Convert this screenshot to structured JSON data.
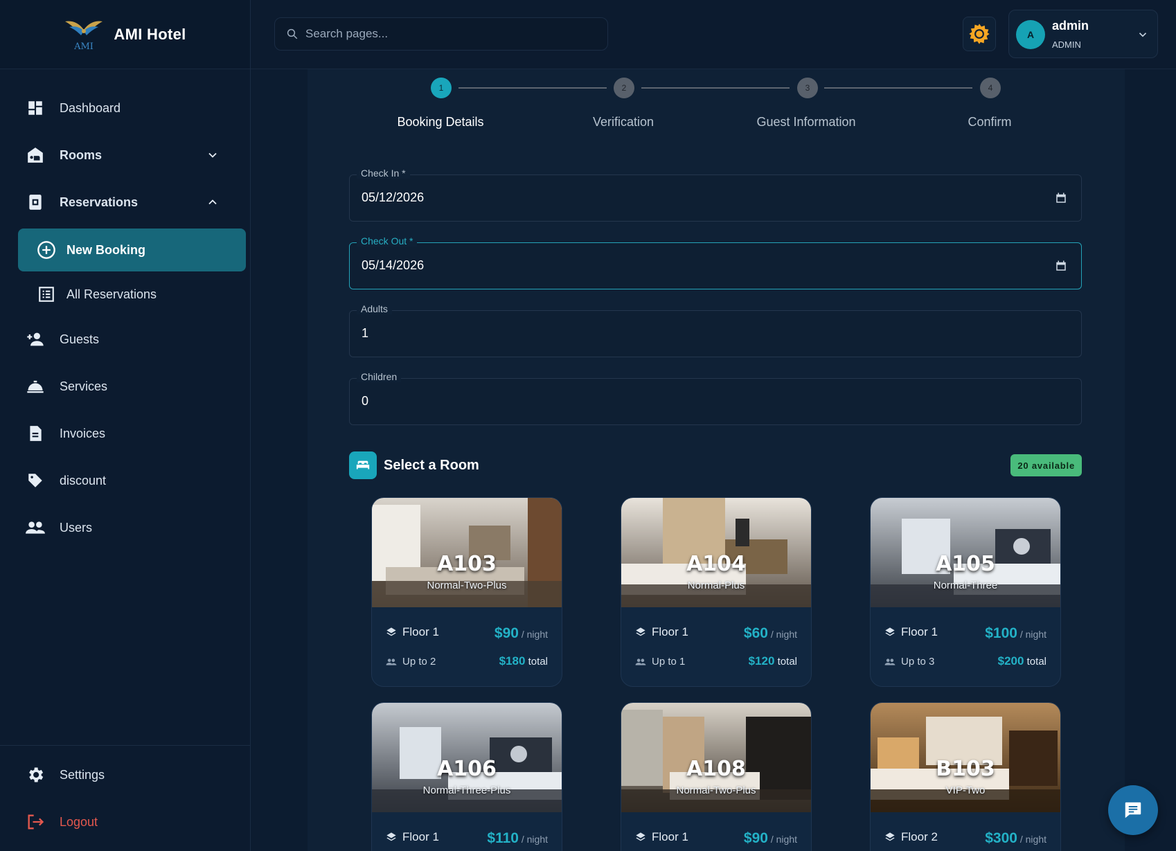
{
  "app": {
    "name": "AMI Hotel",
    "logo_text": "AMI"
  },
  "search": {
    "placeholder": "Search pages..."
  },
  "user": {
    "name": "admin",
    "role": "ADMIN",
    "avatar_letter": "A"
  },
  "sidebar": {
    "items": [
      {
        "label": "Dashboard",
        "icon": "dashboard-icon"
      },
      {
        "label": "Rooms",
        "icon": "hotel-icon"
      },
      {
        "label": "Reservations",
        "icon": "reservations-icon"
      },
      {
        "label": "New Booking",
        "icon": "add-circle-icon",
        "active": true
      },
      {
        "label": "All Reservations",
        "icon": "list-icon"
      },
      {
        "label": "Guests",
        "icon": "add-person-icon"
      },
      {
        "label": "Services",
        "icon": "room-service-icon"
      },
      {
        "label": "Invoices",
        "icon": "document-icon"
      },
      {
        "label": "discount",
        "icon": "tag-icon"
      },
      {
        "label": "Users",
        "icon": "people-icon"
      }
    ],
    "settings_label": "Settings",
    "logout_label": "Logout"
  },
  "stepper": {
    "steps": [
      {
        "number": "1",
        "label": "Booking Details",
        "active": true
      },
      {
        "number": "2",
        "label": "Verification"
      },
      {
        "number": "3",
        "label": "Guest Information"
      },
      {
        "number": "4",
        "label": "Confirm"
      }
    ]
  },
  "form": {
    "check_in": {
      "label": "Check In *",
      "value": "05/12/2026"
    },
    "check_out": {
      "label": "Check Out *",
      "value": "05/14/2026"
    },
    "adults": {
      "label": "Adults",
      "value": "1"
    },
    "children": {
      "label": "Children",
      "value": "0"
    }
  },
  "rooms_section": {
    "title": "Select a Room",
    "available_badge": "20 available"
  },
  "rooms": [
    {
      "number": "A103",
      "type": "Normal-Two-Plus",
      "floor": "Floor 1",
      "price": "$90",
      "per": "/ night",
      "capacity": "Up to 2",
      "total": "$180",
      "total_suffix": "total"
    },
    {
      "number": "A104",
      "type": "Normal-Plus",
      "floor": "Floor 1",
      "price": "$60",
      "per": "/ night",
      "capacity": "Up to 1",
      "total": "$120",
      "total_suffix": "total"
    },
    {
      "number": "A105",
      "type": "Normal-Three",
      "floor": "Floor 1",
      "price": "$100",
      "per": "/ night",
      "capacity": "Up to 3",
      "total": "$200",
      "total_suffix": "total"
    },
    {
      "number": "A106",
      "type": "Normal-Three-Plus",
      "floor": "Floor 1",
      "price": "$110",
      "per": "/ night"
    },
    {
      "number": "A108",
      "type": "Normal-Two-Plus",
      "floor": "Floor 1",
      "price": "$90",
      "per": "/ night"
    },
    {
      "number": "B103",
      "type": "VIP-Two",
      "floor": "Floor 2",
      "price": "$300",
      "per": "/ night"
    }
  ],
  "colors": {
    "accent": "#19a6bb",
    "active_nav": "#17677a",
    "badge": "#49bb7b",
    "logout": "#e4584e",
    "price": "#23b1c6"
  }
}
